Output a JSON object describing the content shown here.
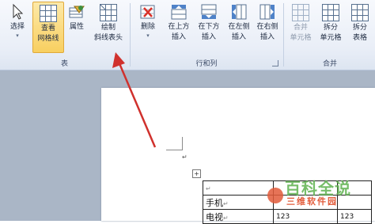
{
  "ribbon": {
    "groups": {
      "table": {
        "label": "表"
      },
      "rows_cols": {
        "label": "行和列"
      },
      "merge": {
        "label": "合并"
      }
    },
    "buttons": {
      "select": "选择",
      "view_gridlines": [
        "查看",
        "网格线"
      ],
      "properties": "属性",
      "draw_diagonal_header": [
        "绘制",
        "斜线表头"
      ],
      "delete": "删除",
      "insert_above": [
        "在上方",
        "插入"
      ],
      "insert_below": [
        "在下方",
        "插入"
      ],
      "insert_left": [
        "在左侧",
        "插入"
      ],
      "insert_right": [
        "在右侧",
        "插入"
      ],
      "merge_cells": [
        "合并",
        "单元格"
      ],
      "split_cells": [
        "拆分",
        "单元格"
      ],
      "split_table": [
        "拆分",
        "表格"
      ]
    },
    "colors": {
      "active_bg": "#f8cf60",
      "delete_x": "#d9322a"
    }
  },
  "document": {
    "table_rows": [
      [
        "",
        "",
        ""
      ],
      [
        "手机",
        "",
        ""
      ],
      [
        "电视",
        "123",
        "123"
      ]
    ],
    "paragraph_mark": "↵",
    "move_handle": "+"
  },
  "watermark": {
    "text": "百科全说",
    "subtext": "三维软件园"
  },
  "annotation": {
    "arrow_color": "#d0312d"
  }
}
